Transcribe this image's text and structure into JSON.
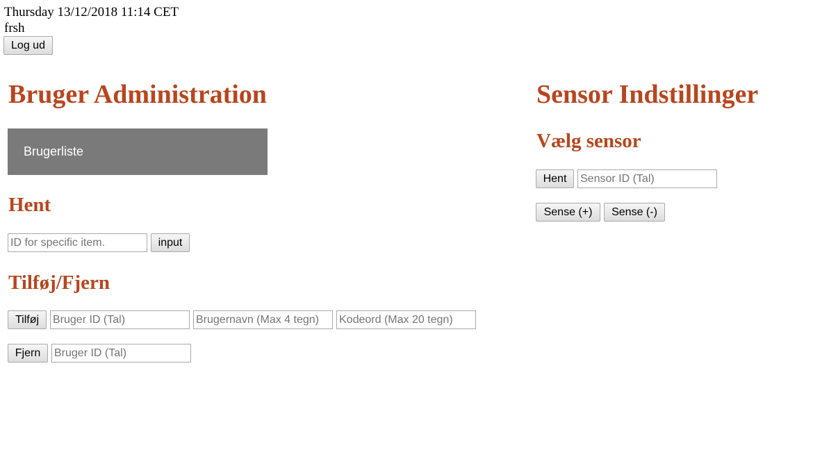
{
  "header": {
    "datetime": "Thursday 13/12/2018 11:14 CET",
    "username": "frsh",
    "logout_label": "Log ud"
  },
  "user_admin": {
    "title": "Bruger Administration",
    "userlist_label": "Brugerliste",
    "fetch": {
      "heading": "Hent",
      "id_placeholder": "ID for specific item.",
      "button_label": "input"
    },
    "add_remove": {
      "heading": "Tilføj/Fjern",
      "add_button": "Tilføj",
      "add_id_placeholder": "Bruger ID (Tal)",
      "add_username_placeholder": "Brugernavn (Max 4 tegn)",
      "add_password_placeholder": "Kodeord (Max 20 tegn)",
      "remove_button": "Fjern",
      "remove_id_placeholder": "Bruger ID (Tal)"
    }
  },
  "sensor_settings": {
    "title": "Sensor Indstillinger",
    "select_heading": "Vælg sensor",
    "fetch_button": "Hent",
    "sensor_id_placeholder": "Sensor ID (Tal)",
    "sense_plus_label": "Sense (+)",
    "sense_minus_label": "Sense (-)"
  },
  "colors": {
    "heading": "#b7461f",
    "userlist_bg": "#7a7a7a"
  }
}
